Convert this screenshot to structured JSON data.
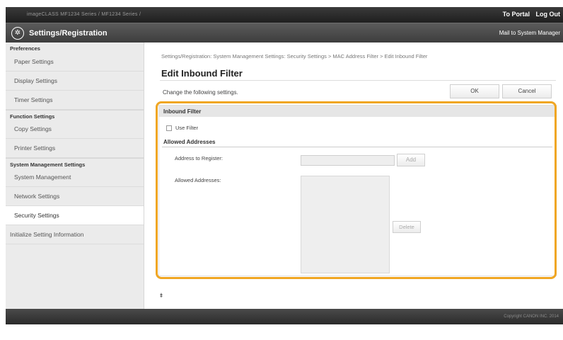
{
  "header": {
    "device_name": "imageCLASS    MF1234 Series / MF1234 Series /",
    "to_portal": "To Portal",
    "log_out": "Log Out",
    "app_title": "Settings/Registration",
    "mail": "Mail to System Manager",
    "logo_icon": "settings-wheel-icon"
  },
  "sidebar": {
    "sections": [
      {
        "title": "Preferences",
        "items": [
          "Paper Settings",
          "Display Settings",
          "Timer Settings"
        ]
      },
      {
        "title": "Function Settings",
        "items": [
          "Copy Settings",
          "Printer Settings"
        ]
      },
      {
        "title": "System Management Settings",
        "items": [
          "System Management",
          "Network Settings",
          "Security Settings"
        ]
      }
    ],
    "extra_item": "Initialize Setting Information",
    "active_item": "Security Settings"
  },
  "main": {
    "breadcrumb": "Settings/Registration: System Management Settings: Security Settings > MAC Address Filter > Edit Inbound Filter",
    "title": "Edit Inbound Filter",
    "instructions": "Change the following settings.",
    "ok_label": "OK",
    "cancel_label": "Cancel",
    "panel_title": "Inbound Filter",
    "use_filter_label": "Use Filter",
    "use_filter_checked": false,
    "allowed_head": "Allowed Addresses",
    "address_label": "Address to Register:",
    "address_value": "",
    "add_label": "Add",
    "allowed_label": "Allowed Addresses:",
    "allowed_list": [],
    "delete_label": "Delete",
    "back_to_top": "⯒",
    "highlight_color": "#f0a623"
  },
  "footer": {
    "copyright": "Copyright CANON INC. 2014"
  }
}
